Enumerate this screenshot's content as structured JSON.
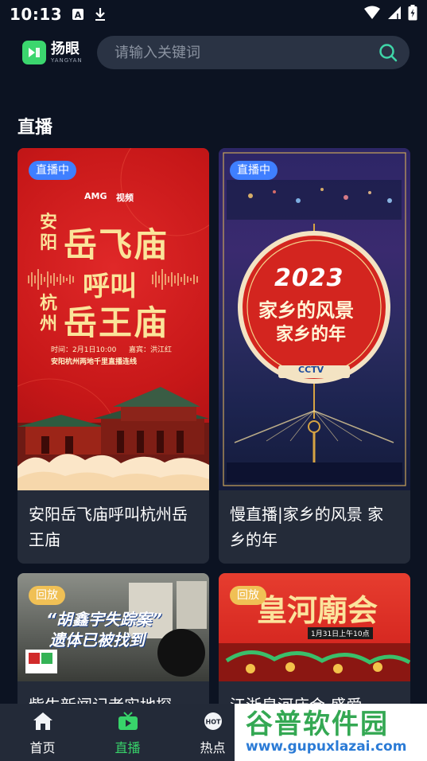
{
  "status_bar": {
    "time": "10:13",
    "icons": [
      "a-notification-icon",
      "download-icon",
      "wifi-icon",
      "signal-icon",
      "battery-icon"
    ]
  },
  "header": {
    "logo_cn": "扬眼",
    "logo_en": "YANGYAN",
    "search_placeholder": "请输入关键词"
  },
  "section": {
    "title": "直播"
  },
  "cards": [
    {
      "badge": "直播中",
      "title": "安阳岳飞庙呼叫杭州岳王庙",
      "poster": {
        "brand_left": "AMG",
        "brand_right": "视频",
        "line_top": "岳飞庙",
        "line_mid": "呼叫",
        "line_bot": "岳王庙",
        "side_top": "安阳",
        "side_bot": "杭州",
        "info1": "时间：2月1日10:00",
        "info2": "嘉宾：洪江红",
        "info3": "安阳杭州两地千里直播连线"
      }
    },
    {
      "badge": "直播中",
      "title": "慢直播|家乡的风景 家乡的年",
      "poster": {
        "year": "2023",
        "line1": "家乡的风景",
        "line2": "家乡的年",
        "logo": "CCTV"
      }
    },
    {
      "badge": "回放",
      "title": "紫牛新闻记者实地探",
      "poster": {
        "headline1": "“胡鑫宇失踪案”",
        "headline2": "遗体已被找到"
      }
    },
    {
      "badge": "回放",
      "title": "江浙皇河庙会 盛爱",
      "poster": {
        "headline": "皇河廟会",
        "sub": "1月31日上午10点"
      }
    }
  ],
  "tabbar": {
    "tabs": [
      {
        "label": "首页",
        "icon": "home-icon",
        "active": false
      },
      {
        "label": "直播",
        "icon": "tv-icon",
        "active": true
      },
      {
        "label": "热点",
        "icon": "hot-icon",
        "active": false
      }
    ]
  },
  "watermark": {
    "cn": "谷普软件园",
    "en": "www.gupuxlazai.com"
  },
  "colors": {
    "background": "#0c1322",
    "card": "#242b39",
    "accent_green": "#38d36a",
    "live_badge": "#3f7fff",
    "replay_badge": "#f0c055"
  }
}
